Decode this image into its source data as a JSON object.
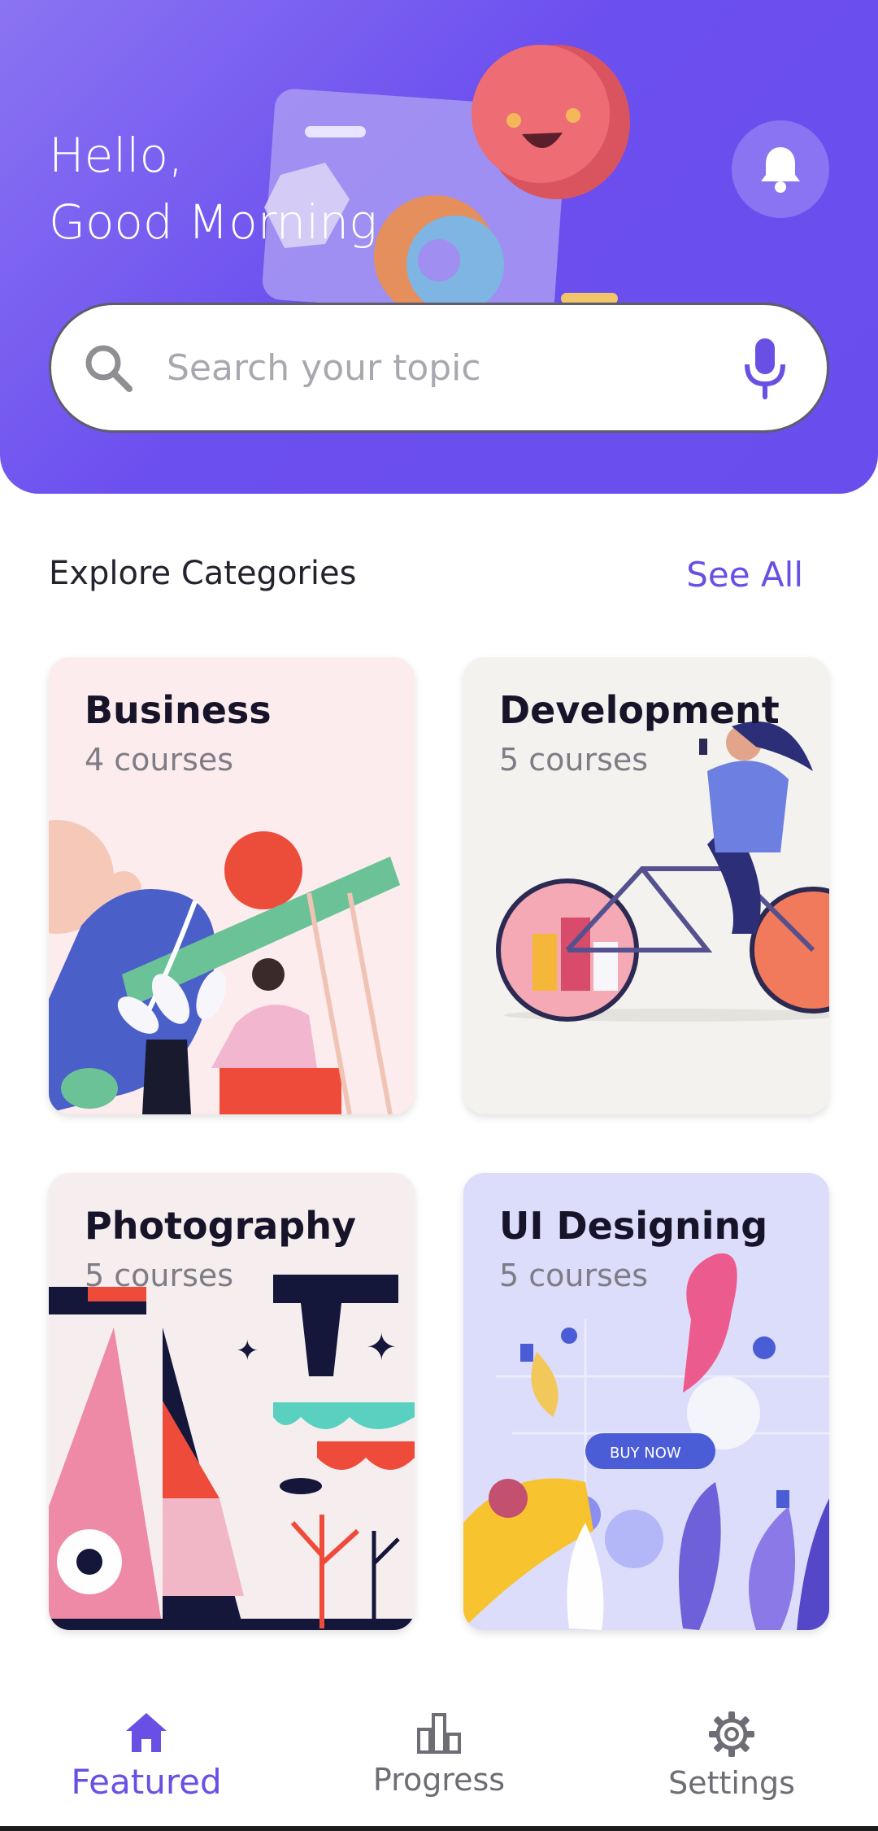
{
  "header": {
    "greeting_line1": "Hello,",
    "greeting_line2": "Good Morning",
    "bell_icon": "bell-icon",
    "colors": {
      "gradient_start": "#8b74f2",
      "gradient_end": "#6a4ded"
    }
  },
  "search": {
    "placeholder": "Search your topic",
    "value": "",
    "left_icon": "search-icon",
    "right_icon": "microphone-icon"
  },
  "categories_section": {
    "title": "Explore Categories",
    "see_all": "See All",
    "accent": "#6a4fe4"
  },
  "categories": [
    {
      "name": "Business",
      "courses": "4 courses",
      "bg": "#fcecee"
    },
    {
      "name": "Development",
      "courses": "5 courses",
      "bg": "#f3f2ef"
    },
    {
      "name": "Photography",
      "courses": "5 courses",
      "bg": "#f6eeee"
    },
    {
      "name": "UI Designing",
      "courses": "5 courses",
      "bg": "#dcdcfb"
    }
  ],
  "bottom_nav": {
    "items": [
      {
        "label": "Featured",
        "icon": "home-icon",
        "active": true
      },
      {
        "label": "Progress",
        "icon": "bar-chart-icon",
        "active": false
      },
      {
        "label": "Settings",
        "icon": "gear-icon",
        "active": false
      }
    ]
  }
}
